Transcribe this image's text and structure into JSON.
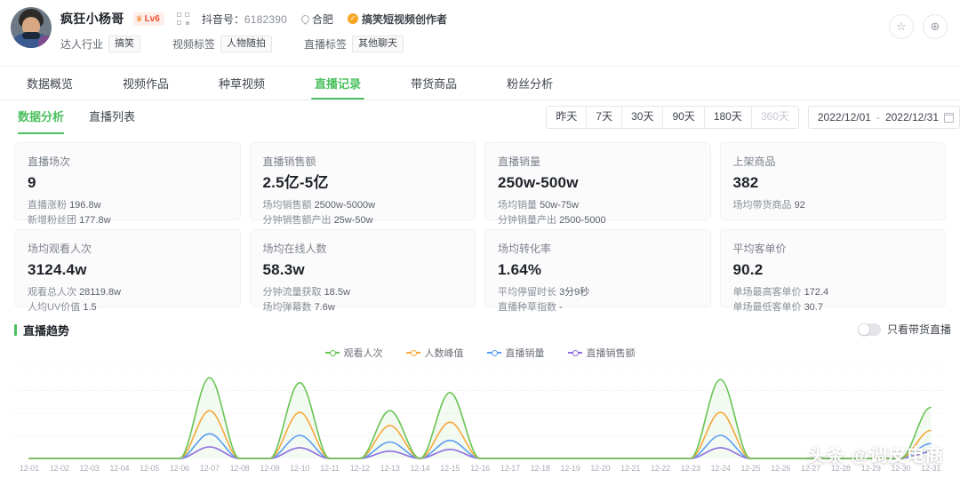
{
  "profile": {
    "nickname": "疯狂小杨哥",
    "level_badge": "Lv6",
    "crown_icon": "crown-icon",
    "qr_icon": "qr-code-icon",
    "douyin_id_label": "抖音号：",
    "douyin_id_value": "6182390",
    "location_icon": "location-pin-icon",
    "location": "合肥",
    "verify_icon": "verified-badge-icon",
    "verify_text": "搞笑短视频创作者",
    "tags": [
      {
        "label": "达人行业",
        "value": "搞笑"
      },
      {
        "label": "视频标签",
        "value": "人物随拍"
      },
      {
        "label": "直播标签",
        "value": "其他聊天"
      }
    ],
    "actions": [
      {
        "name": "favorite-button",
        "glyph": "☆"
      },
      {
        "name": "add-button",
        "glyph": "⊕"
      }
    ]
  },
  "main_tabs": [
    {
      "label": "数据概览",
      "active": false
    },
    {
      "label": "视频作品",
      "active": false
    },
    {
      "label": "种草视频",
      "active": false
    },
    {
      "label": "直播记录",
      "active": true
    },
    {
      "label": "带货商品",
      "active": false
    },
    {
      "label": "粉丝分析",
      "active": false
    }
  ],
  "sub_tabs": [
    {
      "label": "数据分析",
      "active": true
    },
    {
      "label": "直播列表",
      "active": false
    }
  ],
  "filters": {
    "ranges": [
      {
        "label": "昨天",
        "disabled": false
      },
      {
        "label": "7天",
        "disabled": false
      },
      {
        "label": "30天",
        "disabled": false
      },
      {
        "label": "90天",
        "disabled": false
      },
      {
        "label": "180天",
        "disabled": false
      },
      {
        "label": "360天",
        "disabled": true
      }
    ],
    "date_start": "2022/12/01",
    "date_separator": "-",
    "date_end": "2022/12/31",
    "calendar_icon": "calendar-icon"
  },
  "cards": [
    {
      "title": "直播场次",
      "value": "9",
      "subs": [
        {
          "label": "直播涨粉",
          "value": "196.8w"
        },
        {
          "label": "新增粉丝团",
          "value": "177.8w"
        }
      ]
    },
    {
      "title": "直播销售额",
      "value": "2.5亿-5亿",
      "subs": [
        {
          "label": "场均销售额",
          "value": "2500w-5000w"
        },
        {
          "label": "分钟销售额产出",
          "value": "25w-50w"
        }
      ]
    },
    {
      "title": "直播销量",
      "value": "250w-500w",
      "subs": [
        {
          "label": "场均销量",
          "value": "50w-75w"
        },
        {
          "label": "分钟销量产出",
          "value": "2500-5000"
        }
      ]
    },
    {
      "title": "上架商品",
      "value": "382",
      "subs": [
        {
          "label": "场均带货商品",
          "value": "92"
        }
      ]
    },
    {
      "title": "场均观看人次",
      "value": "3124.4w",
      "subs": [
        {
          "label": "观看总人次",
          "value": "28119.8w"
        },
        {
          "label": "人均UV价值",
          "value": "1.5"
        }
      ]
    },
    {
      "title": "场均在线人数",
      "value": "58.3w",
      "subs": [
        {
          "label": "分钟流量获取",
          "value": "18.5w"
        },
        {
          "label": "场均弹幕数",
          "value": "7.6w"
        }
      ]
    },
    {
      "title": "场均转化率",
      "value": "1.64%",
      "subs": [
        {
          "label": "平均停留时长",
          "value": "3分9秒"
        },
        {
          "label": "直播种草指数",
          "value": "-"
        }
      ]
    },
    {
      "title": "平均客单价",
      "value": "90.2",
      "subs": [
        {
          "label": "单场最高客单价",
          "value": "172.4"
        },
        {
          "label": "单场最低客单价",
          "value": "30.7"
        }
      ]
    }
  ],
  "trend": {
    "section_title": "直播趋势",
    "toggle_label": "只看带货直播",
    "toggle_on": false
  },
  "watermark": "头条 @调皮电商",
  "chart_data": {
    "type": "line",
    "title": "直播趋势",
    "xlabel": "",
    "ylabel": "",
    "grid": true,
    "legend_position": "top-center",
    "x": [
      "12-01",
      "12-02",
      "12-03",
      "12-04",
      "12-05",
      "12-06",
      "12-07",
      "12-08",
      "12-09",
      "12-10",
      "12-11",
      "12-12",
      "12-13",
      "12-14",
      "12-15",
      "12-16",
      "12-17",
      "12-18",
      "12-19",
      "12-20",
      "12-21",
      "12-22",
      "12-23",
      "12-24",
      "12-25",
      "12-26",
      "12-27",
      "12-28",
      "12-29",
      "12-30",
      "12-31"
    ],
    "series": [
      {
        "name": "观看人次",
        "color": "#68c453",
        "values": [
          0,
          0,
          0,
          0,
          0,
          0,
          98,
          0,
          0,
          92,
          0,
          0,
          58,
          0,
          80,
          0,
          0,
          0,
          0,
          0,
          0,
          0,
          0,
          96,
          0,
          0,
          0,
          0,
          0,
          0,
          62
        ]
      },
      {
        "name": "人数峰值",
        "color": "#f5a93c",
        "values": [
          0,
          0,
          0,
          0,
          0,
          0,
          58,
          0,
          0,
          56,
          0,
          0,
          40,
          0,
          44,
          0,
          0,
          0,
          0,
          0,
          0,
          0,
          0,
          56,
          0,
          0,
          0,
          0,
          0,
          0,
          34
        ]
      },
      {
        "name": "直播销量",
        "color": "#5b9cf0",
        "values": [
          0,
          0,
          0,
          0,
          0,
          0,
          30,
          0,
          0,
          28,
          0,
          0,
          20,
          0,
          22,
          0,
          0,
          0,
          0,
          0,
          0,
          0,
          0,
          28,
          0,
          0,
          0,
          0,
          0,
          0,
          18
        ]
      },
      {
        "name": "直播销售额",
        "color": "#8d6ee0",
        "values": [
          0,
          0,
          0,
          0,
          0,
          0,
          14,
          0,
          0,
          13,
          0,
          0,
          9,
          0,
          11,
          0,
          0,
          0,
          0,
          0,
          0,
          0,
          0,
          13,
          0,
          0,
          0,
          0,
          0,
          0,
          8
        ]
      }
    ],
    "ylim": [
      0,
      110
    ]
  }
}
